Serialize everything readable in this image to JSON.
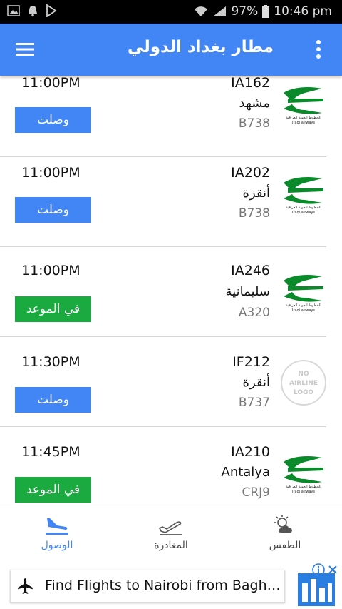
{
  "status_bar": {
    "battery": "97%",
    "time": "10:46 pm"
  },
  "app_bar": {
    "title": "مطار بغداد الدولي"
  },
  "colors": {
    "primary": "#4285f4",
    "arrived": "#4285f4",
    "ontime": "#1aaa40",
    "airline_green": "#0a8a2a"
  },
  "flights": [
    {
      "time": "11:00PM",
      "status": "وصلت",
      "status_type": "arrived",
      "flight": "IA162",
      "city": "مشهد",
      "aircraft": "B738",
      "logo": "iraqi-airways"
    },
    {
      "time": "11:00PM",
      "status": "وصلت",
      "status_type": "arrived",
      "flight": "IA202",
      "city": "أنقرة",
      "aircraft": "B738",
      "logo": "iraqi-airways"
    },
    {
      "time": "11:00PM",
      "status": "في الموعد",
      "status_type": "ontime",
      "flight": "IA246",
      "city": "سليمانية",
      "aircraft": "A320",
      "logo": "iraqi-airways"
    },
    {
      "time": "11:30PM",
      "status": "وصلت",
      "status_type": "arrived",
      "flight": "IF212",
      "city": "أنقرة",
      "aircraft": "B737",
      "logo": "no-airline-logo"
    },
    {
      "time": "11:45PM",
      "status": "في الموعد",
      "status_type": "ontime",
      "flight": "IA210",
      "city": "Antalya",
      "aircraft": "CRJ9",
      "logo": "iraqi-airways"
    }
  ],
  "logos": {
    "iraqi_arabic": "الخطوط الجوية العراقية",
    "iraqi_english": "Iraqi airways",
    "no_logo_lines": [
      "NO",
      "AIRLINE",
      "LOGO"
    ]
  },
  "bottom_nav": {
    "arrivals": "الوصول",
    "departures": "المغادرة",
    "weather": "الطقس",
    "active": "arrivals"
  },
  "ad": {
    "text": "Find Flights to Nairobi from Bagh…"
  }
}
